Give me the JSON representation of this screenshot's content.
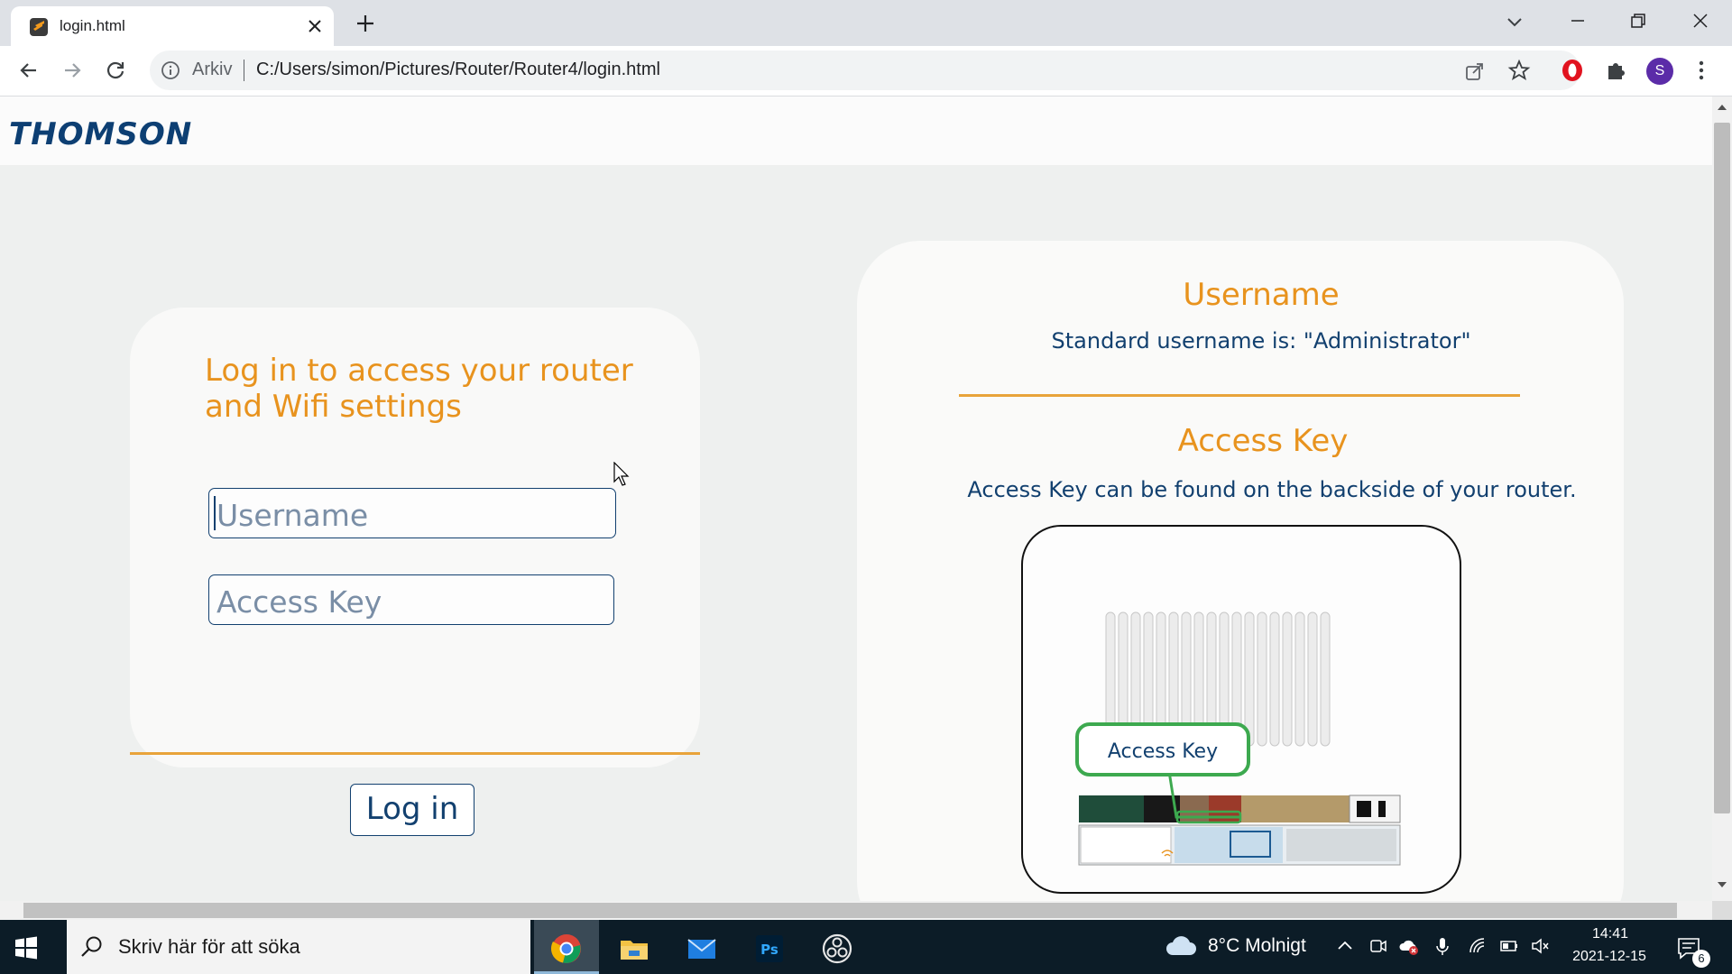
{
  "browser": {
    "tab_title": "login.html",
    "site_info_label": "Arkiv",
    "url": "C:/Users/simon/Pictures/Router/Router4/login.html",
    "profile_initial": "S"
  },
  "page": {
    "brand": "THOMSON",
    "login": {
      "heading": "Log in to access your router and Wifi settings",
      "username_placeholder": "Username",
      "accesskey_placeholder": "Access Key",
      "button_label": "Log in"
    },
    "info": {
      "username_title": "Username",
      "username_text": "Standard username is: \"Administrator\"",
      "accesskey_title": "Access Key",
      "accesskey_text": "Access Key can be found on the backside of your router.",
      "diagram_callout": "Access Key"
    },
    "colors": {
      "accent": "#e8931e",
      "navy": "#12406f",
      "page_background": "#eef0ef"
    }
  },
  "taskbar": {
    "search_placeholder": "Skriv här för att söka",
    "weather": "8°C  Molnigt",
    "time": "14:41",
    "date": "2021-12-15",
    "notification_count": "6",
    "apps": [
      "chrome-icon",
      "file-explorer-icon",
      "mail-icon",
      "photoshop-icon",
      "obs-icon"
    ]
  }
}
